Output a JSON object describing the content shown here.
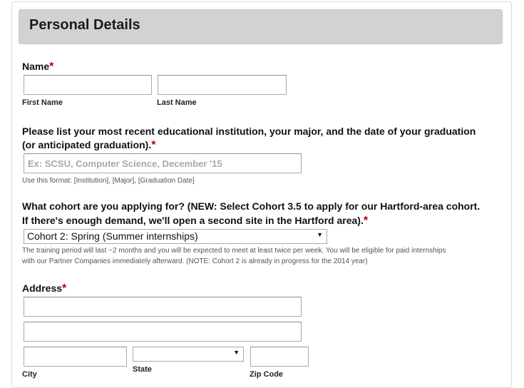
{
  "section": {
    "title": "Personal Details"
  },
  "name": {
    "label": "Name",
    "required": "*",
    "first_label": "First Name",
    "last_label": "Last Name"
  },
  "education": {
    "label_line1": "Please list your most recent educational institution, your major, and the date of your graduation",
    "label_line2": "(or anticipated graduation).",
    "required": "*",
    "placeholder": "Ex: SCSU, Computer Science, December '15",
    "help": "Use this format: [Institution], [Major], [Graduation Date]"
  },
  "cohort": {
    "label_line1": "What cohort are you applying for? (NEW: Select Cohort 3.5 to apply for our Hartford-area cohort.",
    "label_line2": "If there's enough demand, we'll open a second site in the Hartford area).",
    "required": "*",
    "selected": "Cohort 2: Spring (Summer internships)",
    "arrow": "▼",
    "help_line1": "The training period will last ~2 months and you will be expected to meet at least twice per week. You will be eligible for paid internships",
    "help_line2": "with our Partner Companies immediately afterward. (NOTE: Cohort 2 is already in progress for the 2014 year)"
  },
  "address": {
    "label": "Address",
    "required": "*",
    "city_label": "City",
    "state_label": "State",
    "state_arrow": "▼",
    "zip_label": "Zip Code"
  }
}
